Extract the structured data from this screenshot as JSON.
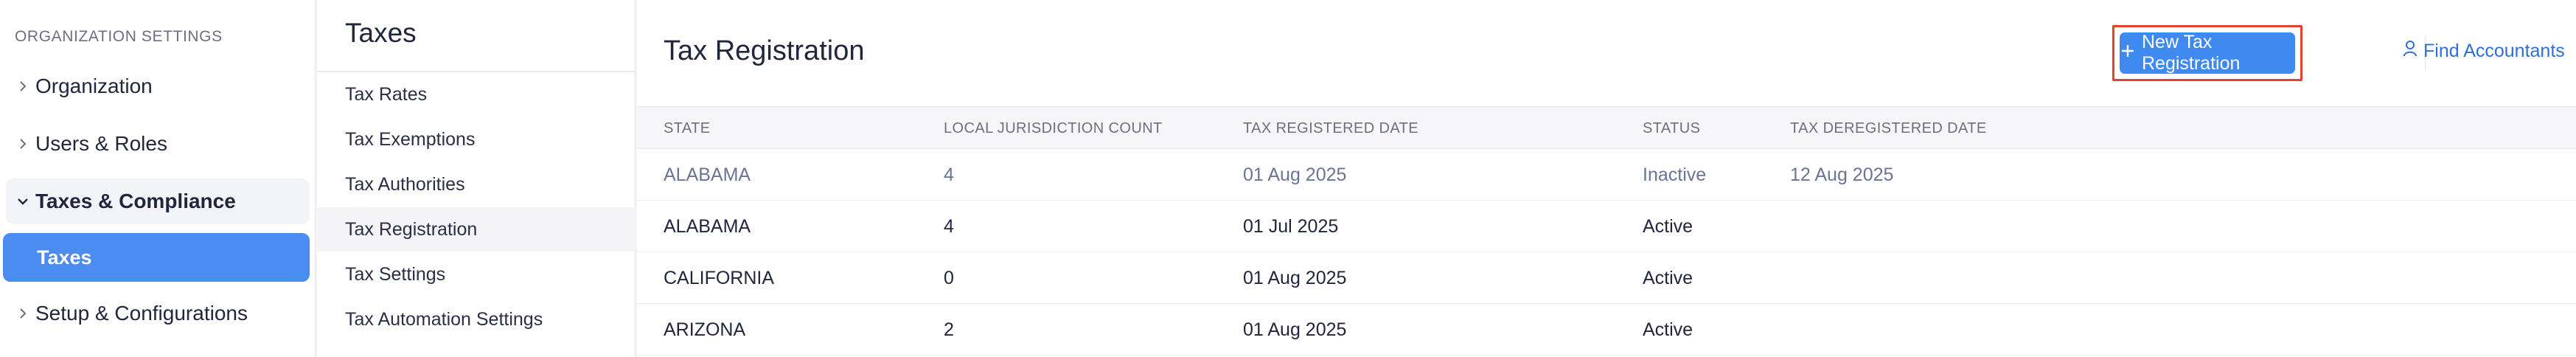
{
  "sidebar": {
    "heading": "ORGANIZATION SETTINGS",
    "items": [
      {
        "label": "Organization"
      },
      {
        "label": "Users & Roles"
      },
      {
        "label": "Taxes & Compliance"
      },
      {
        "label": "Setup & Configurations"
      }
    ],
    "sub_item": "Taxes"
  },
  "midnav": {
    "title": "Taxes",
    "items": [
      {
        "label": "Tax Rates"
      },
      {
        "label": "Tax Exemptions"
      },
      {
        "label": "Tax Authorities"
      },
      {
        "label": "Tax Registration"
      },
      {
        "label": "Tax Settings"
      },
      {
        "label": "Tax Automation Settings"
      }
    ]
  },
  "main": {
    "title": "Tax Registration",
    "new_button": "New Tax Registration",
    "find_link": "Find Accountants",
    "columns": [
      "STATE",
      "LOCAL JURISDICTION COUNT",
      "TAX REGISTERED DATE",
      "STATUS",
      "TAX DEREGISTERED DATE"
    ],
    "rows": [
      {
        "state": "ALABAMA",
        "count": "4",
        "registered": "01 Aug 2025",
        "status": "Inactive",
        "deregistered": "12 Aug 2025"
      },
      {
        "state": "ALABAMA",
        "count": "4",
        "registered": "01 Jul 2025",
        "status": "Active",
        "deregistered": ""
      },
      {
        "state": "CALIFORNIA",
        "count": "0",
        "registered": "01 Aug 2025",
        "status": "Active",
        "deregistered": ""
      },
      {
        "state": "ARIZONA",
        "count": "2",
        "registered": "01 Aug 2025",
        "status": "Active",
        "deregistered": ""
      }
    ]
  },
  "colors": {
    "accent": "#3f8af0",
    "highlight": "#e5412d",
    "inactive_text": "#6a7494"
  },
  "icons": [
    "chevron-right-icon",
    "chevron-down-icon",
    "plus-icon",
    "user-icon"
  ]
}
